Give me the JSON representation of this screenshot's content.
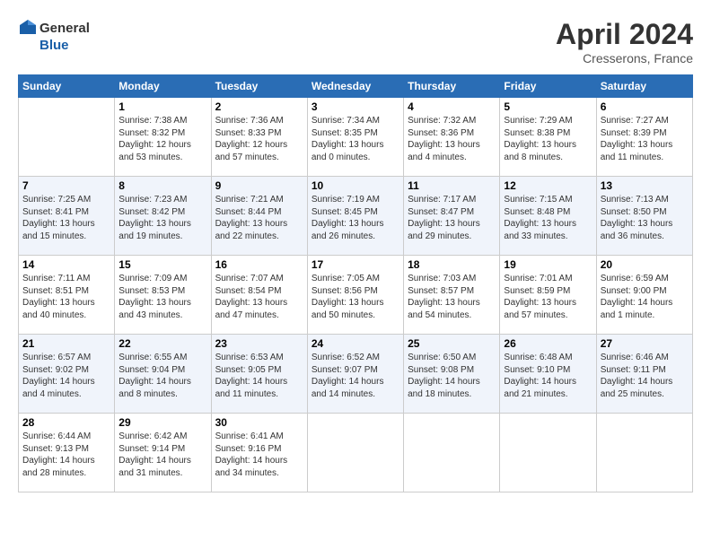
{
  "logo": {
    "line1": "General",
    "line2": "Blue"
  },
  "title": "April 2024",
  "location": "Cresserons, France",
  "days_of_week": [
    "Sunday",
    "Monday",
    "Tuesday",
    "Wednesday",
    "Thursday",
    "Friday",
    "Saturday"
  ],
  "weeks": [
    [
      {
        "day": "",
        "sunrise": "",
        "sunset": "",
        "daylight": ""
      },
      {
        "day": "1",
        "sunrise": "Sunrise: 7:38 AM",
        "sunset": "Sunset: 8:32 PM",
        "daylight": "Daylight: 12 hours and 53 minutes."
      },
      {
        "day": "2",
        "sunrise": "Sunrise: 7:36 AM",
        "sunset": "Sunset: 8:33 PM",
        "daylight": "Daylight: 12 hours and 57 minutes."
      },
      {
        "day": "3",
        "sunrise": "Sunrise: 7:34 AM",
        "sunset": "Sunset: 8:35 PM",
        "daylight": "Daylight: 13 hours and 0 minutes."
      },
      {
        "day": "4",
        "sunrise": "Sunrise: 7:32 AM",
        "sunset": "Sunset: 8:36 PM",
        "daylight": "Daylight: 13 hours and 4 minutes."
      },
      {
        "day": "5",
        "sunrise": "Sunrise: 7:29 AM",
        "sunset": "Sunset: 8:38 PM",
        "daylight": "Daylight: 13 hours and 8 minutes."
      },
      {
        "day": "6",
        "sunrise": "Sunrise: 7:27 AM",
        "sunset": "Sunset: 8:39 PM",
        "daylight": "Daylight: 13 hours and 11 minutes."
      }
    ],
    [
      {
        "day": "7",
        "sunrise": "Sunrise: 7:25 AM",
        "sunset": "Sunset: 8:41 PM",
        "daylight": "Daylight: 13 hours and 15 minutes."
      },
      {
        "day": "8",
        "sunrise": "Sunrise: 7:23 AM",
        "sunset": "Sunset: 8:42 PM",
        "daylight": "Daylight: 13 hours and 19 minutes."
      },
      {
        "day": "9",
        "sunrise": "Sunrise: 7:21 AM",
        "sunset": "Sunset: 8:44 PM",
        "daylight": "Daylight: 13 hours and 22 minutes."
      },
      {
        "day": "10",
        "sunrise": "Sunrise: 7:19 AM",
        "sunset": "Sunset: 8:45 PM",
        "daylight": "Daylight: 13 hours and 26 minutes."
      },
      {
        "day": "11",
        "sunrise": "Sunrise: 7:17 AM",
        "sunset": "Sunset: 8:47 PM",
        "daylight": "Daylight: 13 hours and 29 minutes."
      },
      {
        "day": "12",
        "sunrise": "Sunrise: 7:15 AM",
        "sunset": "Sunset: 8:48 PM",
        "daylight": "Daylight: 13 hours and 33 minutes."
      },
      {
        "day": "13",
        "sunrise": "Sunrise: 7:13 AM",
        "sunset": "Sunset: 8:50 PM",
        "daylight": "Daylight: 13 hours and 36 minutes."
      }
    ],
    [
      {
        "day": "14",
        "sunrise": "Sunrise: 7:11 AM",
        "sunset": "Sunset: 8:51 PM",
        "daylight": "Daylight: 13 hours and 40 minutes."
      },
      {
        "day": "15",
        "sunrise": "Sunrise: 7:09 AM",
        "sunset": "Sunset: 8:53 PM",
        "daylight": "Daylight: 13 hours and 43 minutes."
      },
      {
        "day": "16",
        "sunrise": "Sunrise: 7:07 AM",
        "sunset": "Sunset: 8:54 PM",
        "daylight": "Daylight: 13 hours and 47 minutes."
      },
      {
        "day": "17",
        "sunrise": "Sunrise: 7:05 AM",
        "sunset": "Sunset: 8:56 PM",
        "daylight": "Daylight: 13 hours and 50 minutes."
      },
      {
        "day": "18",
        "sunrise": "Sunrise: 7:03 AM",
        "sunset": "Sunset: 8:57 PM",
        "daylight": "Daylight: 13 hours and 54 minutes."
      },
      {
        "day": "19",
        "sunrise": "Sunrise: 7:01 AM",
        "sunset": "Sunset: 8:59 PM",
        "daylight": "Daylight: 13 hours and 57 minutes."
      },
      {
        "day": "20",
        "sunrise": "Sunrise: 6:59 AM",
        "sunset": "Sunset: 9:00 PM",
        "daylight": "Daylight: 14 hours and 1 minute."
      }
    ],
    [
      {
        "day": "21",
        "sunrise": "Sunrise: 6:57 AM",
        "sunset": "Sunset: 9:02 PM",
        "daylight": "Daylight: 14 hours and 4 minutes."
      },
      {
        "day": "22",
        "sunrise": "Sunrise: 6:55 AM",
        "sunset": "Sunset: 9:04 PM",
        "daylight": "Daylight: 14 hours and 8 minutes."
      },
      {
        "day": "23",
        "sunrise": "Sunrise: 6:53 AM",
        "sunset": "Sunset: 9:05 PM",
        "daylight": "Daylight: 14 hours and 11 minutes."
      },
      {
        "day": "24",
        "sunrise": "Sunrise: 6:52 AM",
        "sunset": "Sunset: 9:07 PM",
        "daylight": "Daylight: 14 hours and 14 minutes."
      },
      {
        "day": "25",
        "sunrise": "Sunrise: 6:50 AM",
        "sunset": "Sunset: 9:08 PM",
        "daylight": "Daylight: 14 hours and 18 minutes."
      },
      {
        "day": "26",
        "sunrise": "Sunrise: 6:48 AM",
        "sunset": "Sunset: 9:10 PM",
        "daylight": "Daylight: 14 hours and 21 minutes."
      },
      {
        "day": "27",
        "sunrise": "Sunrise: 6:46 AM",
        "sunset": "Sunset: 9:11 PM",
        "daylight": "Daylight: 14 hours and 25 minutes."
      }
    ],
    [
      {
        "day": "28",
        "sunrise": "Sunrise: 6:44 AM",
        "sunset": "Sunset: 9:13 PM",
        "daylight": "Daylight: 14 hours and 28 minutes."
      },
      {
        "day": "29",
        "sunrise": "Sunrise: 6:42 AM",
        "sunset": "Sunset: 9:14 PM",
        "daylight": "Daylight: 14 hours and 31 minutes."
      },
      {
        "day": "30",
        "sunrise": "Sunrise: 6:41 AM",
        "sunset": "Sunset: 9:16 PM",
        "daylight": "Daylight: 14 hours and 34 minutes."
      },
      {
        "day": "",
        "sunrise": "",
        "sunset": "",
        "daylight": ""
      },
      {
        "day": "",
        "sunrise": "",
        "sunset": "",
        "daylight": ""
      },
      {
        "day": "",
        "sunrise": "",
        "sunset": "",
        "daylight": ""
      },
      {
        "day": "",
        "sunrise": "",
        "sunset": "",
        "daylight": ""
      }
    ]
  ]
}
